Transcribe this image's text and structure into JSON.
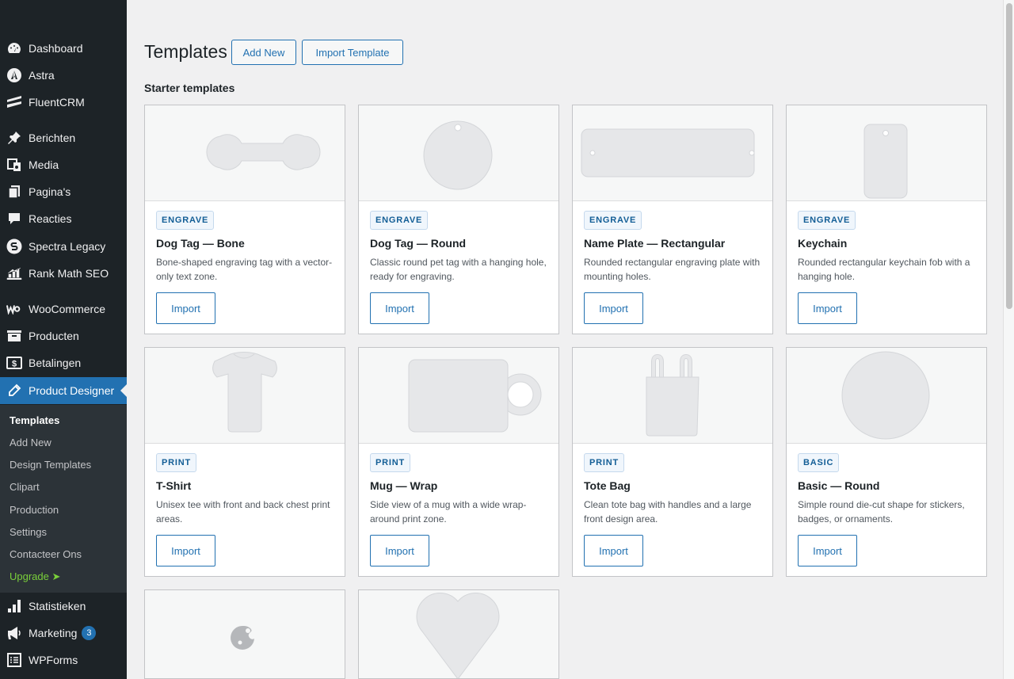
{
  "sidebar": {
    "items": [
      {
        "label": "Dashboard",
        "icon": "dashboard-icon"
      },
      {
        "label": "Astra",
        "icon": "astra-icon"
      },
      {
        "label": "FluentCRM",
        "icon": "fluentcrm-icon"
      },
      {
        "label": "Berichten",
        "icon": "pin-icon"
      },
      {
        "label": "Media",
        "icon": "media-icon"
      },
      {
        "label": "Pagina's",
        "icon": "pages-icon"
      },
      {
        "label": "Reacties",
        "icon": "comments-icon"
      },
      {
        "label": "Spectra Legacy",
        "icon": "spectra-icon"
      },
      {
        "label": "Rank Math SEO",
        "icon": "rankmath-icon"
      },
      {
        "label": "WooCommerce",
        "icon": "woocommerce-icon"
      },
      {
        "label": "Producten",
        "icon": "products-icon"
      },
      {
        "label": "Betalingen",
        "icon": "payments-icon"
      },
      {
        "label": "Product Designer",
        "icon": "pencil-icon"
      },
      {
        "label": "Statistieken",
        "icon": "stats-icon"
      },
      {
        "label": "Marketing",
        "icon": "megaphone-icon",
        "badge": "3"
      },
      {
        "label": "WPForms",
        "icon": "wpforms-icon"
      }
    ],
    "submenu": [
      {
        "label": "Templates"
      },
      {
        "label": "Add New"
      },
      {
        "label": "Design Templates"
      },
      {
        "label": "Clipart"
      },
      {
        "label": "Production"
      },
      {
        "label": "Settings"
      },
      {
        "label": "Contacteer Ons"
      },
      {
        "label": "Upgrade ➤"
      }
    ],
    "active_color": "#2271b1",
    "upgrade_color": "#7ad03a"
  },
  "header": {
    "title": "Templates",
    "add_new_label": "Add New",
    "import_label": "Import Template"
  },
  "section": {
    "title": "Starter templates"
  },
  "cards": [
    {
      "tag": "ENGRAVE",
      "title": "Dog Tag — Bone",
      "desc": "Bone-shaped engraving tag with a vector-only text zone.",
      "button": "Import"
    },
    {
      "tag": "ENGRAVE",
      "title": "Dog Tag — Round",
      "desc": "Classic round pet tag with a hanging hole, ready for engraving.",
      "button": "Import"
    },
    {
      "tag": "ENGRAVE",
      "title": "Name Plate — Rectangular",
      "desc": "Rounded rectangular engraving plate with mounting holes.",
      "button": "Import"
    },
    {
      "tag": "ENGRAVE",
      "title": "Keychain",
      "desc": "Rounded rectangular keychain fob with a hanging hole.",
      "button": "Import"
    },
    {
      "tag": "PRINT",
      "title": "T-Shirt",
      "desc": "Unisex tee with front and back chest print areas.",
      "button": "Import"
    },
    {
      "tag": "PRINT",
      "title": "Mug — Wrap",
      "desc": "Side view of a mug with a wide wrap-around print zone.",
      "button": "Import"
    },
    {
      "tag": "PRINT",
      "title": "Tote Bag",
      "desc": "Clean tote bag with handles and a large front design area.",
      "button": "Import"
    },
    {
      "tag": "BASIC",
      "title": "Basic — Round",
      "desc": "Simple round die-cut shape for stickers, badges, or ornaments.",
      "button": "Import"
    }
  ],
  "partial_cards": [
    {
      "thumb": "palette-icon"
    },
    {
      "thumb": "heart-shape"
    }
  ]
}
